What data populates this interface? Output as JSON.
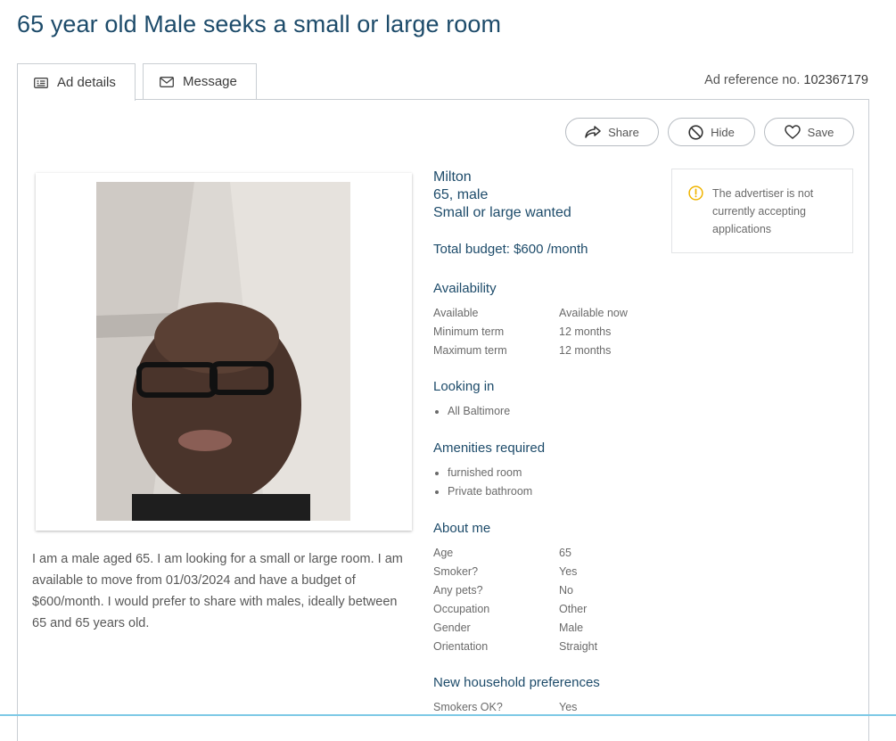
{
  "page": {
    "title": "65 year old Male seeks a small or large room"
  },
  "tabs": {
    "ad_details": "Ad details",
    "message": "Message"
  },
  "ad_reference": {
    "label": "Ad reference no.",
    "number": "102367179"
  },
  "actions": {
    "share": "Share",
    "hide": "Hide",
    "save": "Save"
  },
  "summary": {
    "name": "Milton",
    "age_gender": "65, male",
    "wanted": "Small or large wanted",
    "budget": "Total budget: $600 /month"
  },
  "notice": {
    "text": "The advertiser is not currently accepting applications",
    "icon": "alert-circle-icon",
    "color": "#f0b400"
  },
  "availability": {
    "heading": "Availability",
    "rows": [
      {
        "label": "Available",
        "value": "Available now"
      },
      {
        "label": "Minimum term",
        "value": "12 months"
      },
      {
        "label": "Maximum term",
        "value": "12 months"
      }
    ]
  },
  "looking_in": {
    "heading": "Looking in",
    "items": [
      "All Baltimore"
    ]
  },
  "amenities": {
    "heading": "Amenities required",
    "items": [
      "furnished room",
      "Private bathroom"
    ]
  },
  "about_me": {
    "heading": "About me",
    "rows": [
      {
        "label": "Age",
        "value": "65"
      },
      {
        "label": "Smoker?",
        "value": "Yes"
      },
      {
        "label": "Any pets?",
        "value": "No"
      },
      {
        "label": "Occupation",
        "value": "Other"
      },
      {
        "label": "Gender",
        "value": "Male"
      },
      {
        "label": "Orientation",
        "value": "Straight"
      }
    ]
  },
  "household_prefs": {
    "heading": "New household preferences",
    "rows": [
      {
        "label": "Smokers OK?",
        "value": "Yes"
      }
    ]
  },
  "description": "I am a male aged 65. I am looking for a small or large room. I am available to move from 01/03/2024 and have a budget of $600/month. I would prefer to share with males, ideally between 65 and 65 years old.",
  "colors": {
    "heading": "#1d4b6a",
    "border": "#c9ced3",
    "accent_line": "#7ec9e6"
  }
}
